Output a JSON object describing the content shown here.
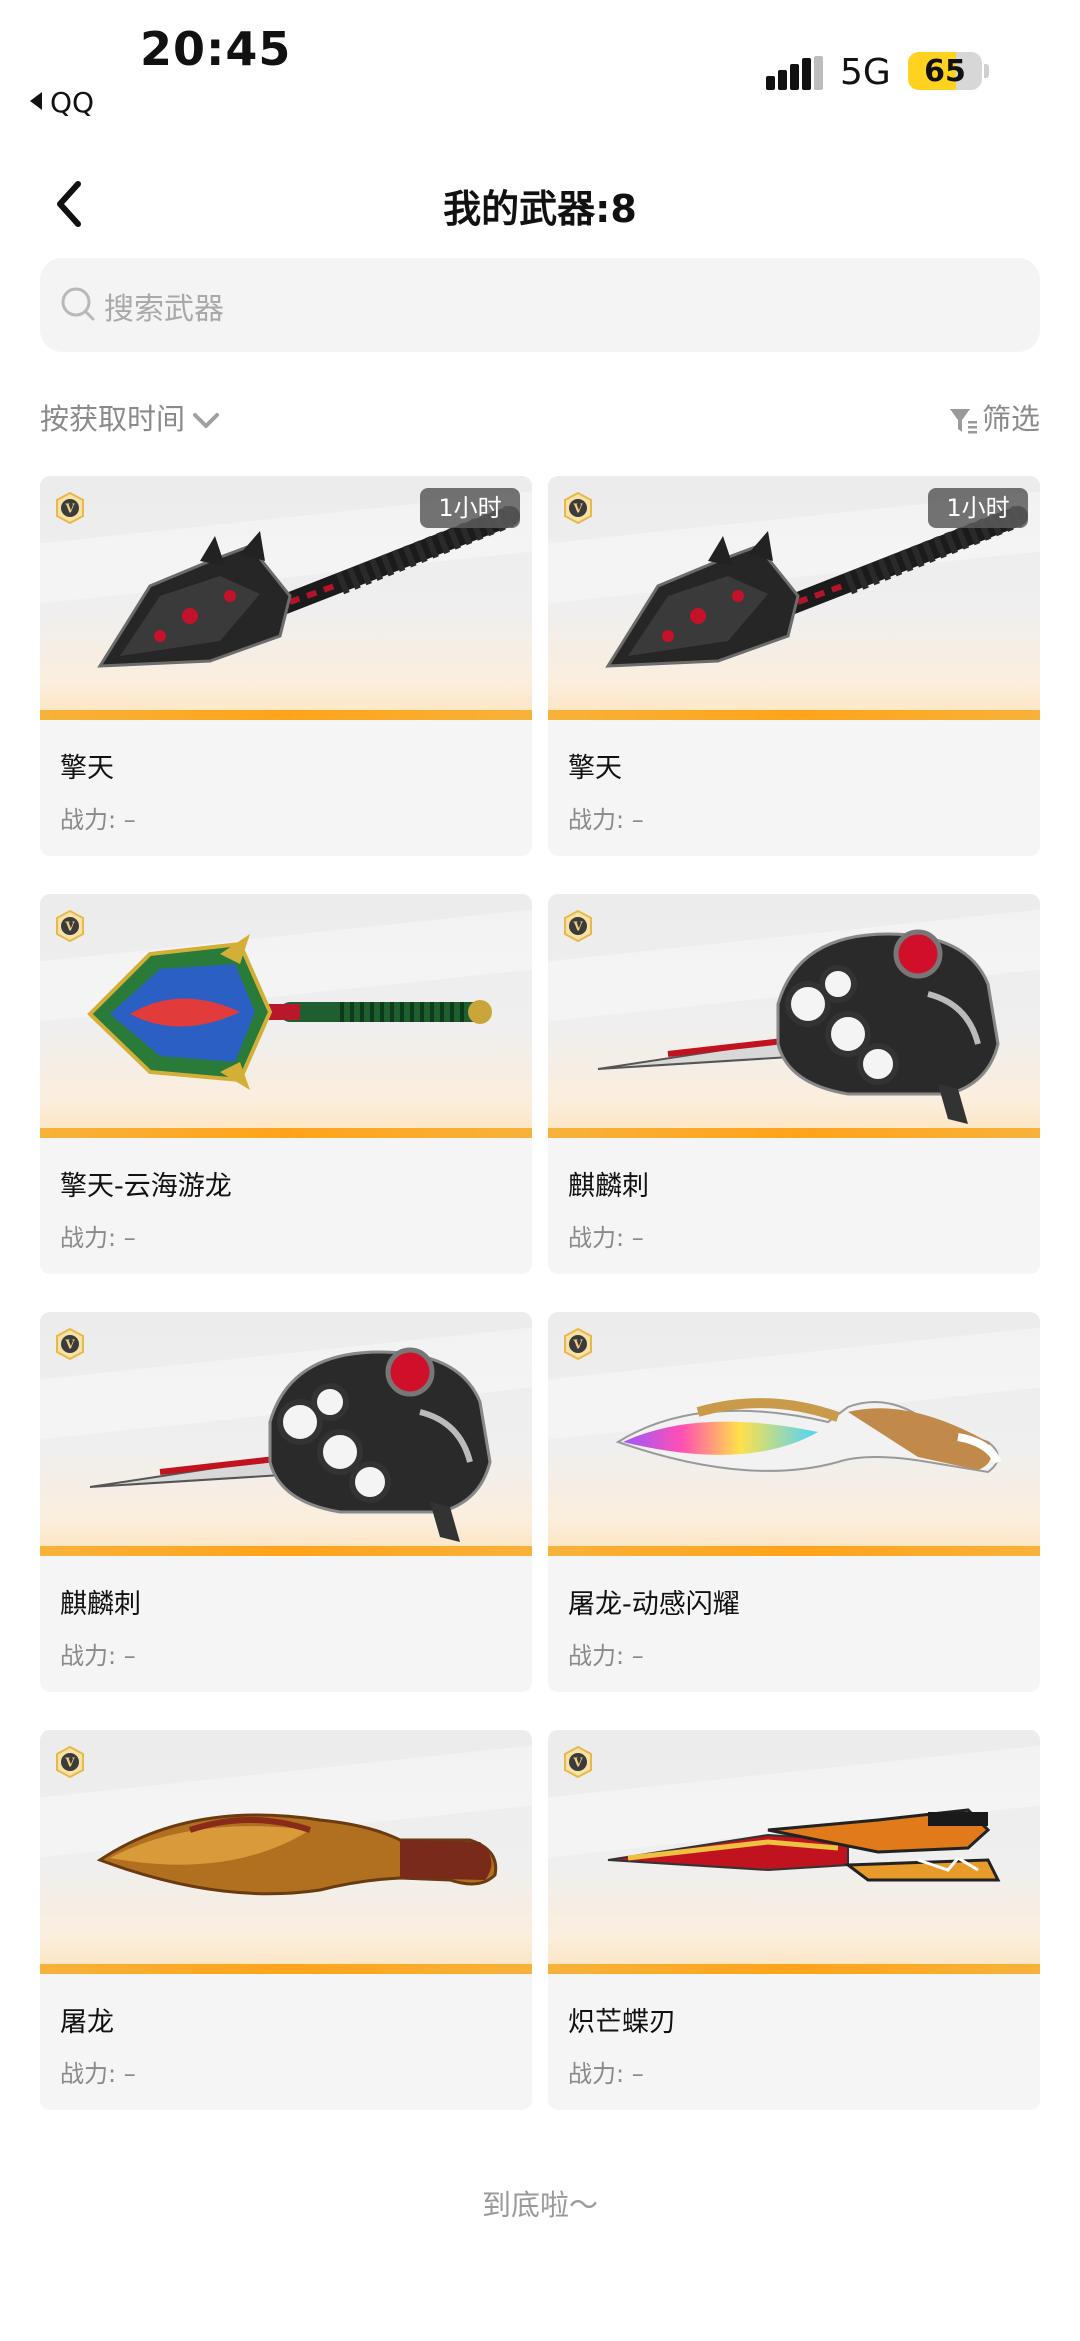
{
  "status_bar": {
    "time": "20:45",
    "back_app": "QQ",
    "network": "5G",
    "battery": "65",
    "battery_level": 0.65
  },
  "header": {
    "title": "我的武器:8"
  },
  "search": {
    "placeholder": "搜索武器"
  },
  "toolbar": {
    "sort_label": "按获取时间",
    "filter_label": "筛选"
  },
  "weapons": [
    {
      "name": "擎天",
      "power": "战力: –",
      "badge": "1小时",
      "type": "shovel-dark"
    },
    {
      "name": "擎天",
      "power": "战力: –",
      "badge": "1小时",
      "type": "shovel-dark"
    },
    {
      "name": "擎天-云海游龙",
      "power": "战力: –",
      "badge": "",
      "type": "shovel-dragon"
    },
    {
      "name": "麒麟刺",
      "power": "战力: –",
      "badge": "",
      "type": "knuckle"
    },
    {
      "name": "麒麟刺",
      "power": "战力: –",
      "badge": "",
      "type": "knuckle"
    },
    {
      "name": "屠龙-动感闪耀",
      "power": "战力: –",
      "badge": "",
      "type": "kukri-rainbow"
    },
    {
      "name": "屠龙",
      "power": "战力: –",
      "badge": "",
      "type": "kukri-gold"
    },
    {
      "name": "炽芒蝶刃",
      "power": "战力: –",
      "badge": "",
      "type": "butterfly"
    }
  ],
  "footer": {
    "end_text": "到底啦～"
  },
  "colors": {
    "accent_bar": "#ffa31a",
    "battery": "#ffd21f",
    "vip_badge": "#e8b84a"
  }
}
